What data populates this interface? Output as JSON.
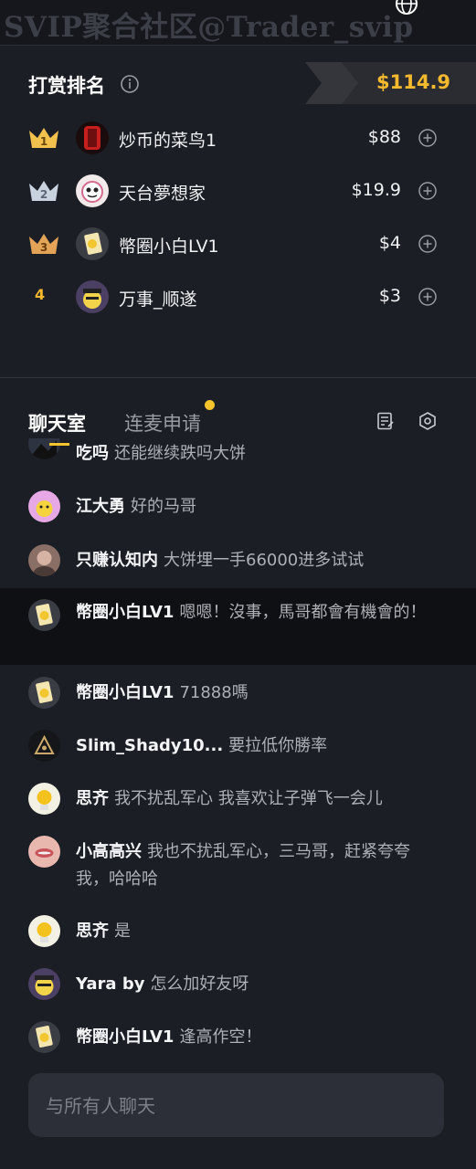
{
  "watermark": "SVIP聚合社区@Trader_svip",
  "rank": {
    "title": "打赏排名",
    "total": "$114.9",
    "entries": [
      {
        "rank": "1",
        "name": "炒币的菜鸟1",
        "amount": "$88"
      },
      {
        "rank": "2",
        "name": "天台夢想家",
        "amount": "$19.9"
      },
      {
        "rank": "3",
        "name": "幣圈小白LV1",
        "amount": "$4"
      },
      {
        "rank": "4",
        "name": "万事_顺遂",
        "amount": "$3"
      }
    ]
  },
  "tabs": {
    "chat": "聊天室",
    "mic": "连麦申请"
  },
  "messages": [
    {
      "user": "吃吗",
      "text": "还能继续跌吗大饼"
    },
    {
      "user": "江大勇",
      "text": "好的马哥"
    },
    {
      "user": "只赚认知内",
      "text": "大饼埋一手66000进多试试"
    },
    {
      "user": "幣圈小白LV1",
      "text": "嗯嗯！沒事，馬哥都會有機會的！"
    },
    {
      "user": "幣圈小白LV1",
      "text": "71888嗎"
    },
    {
      "user": "Slim_Shady10...",
      "text": "要拉低你勝率"
    },
    {
      "user": "思齐",
      "text": "我不扰乱军心 我喜欢让子弹飞一会儿"
    },
    {
      "user": "小高高兴",
      "text": "我也不扰乱军心，三马哥，赶紧夸夸我，哈哈哈"
    },
    {
      "user": "思齐",
      "text": "是"
    },
    {
      "user": "Yara by",
      "text": "怎么加好友呀"
    },
    {
      "user": "幣圈小白LV1",
      "text": "逢高作空！"
    }
  ],
  "input": {
    "placeholder": "与所有人聊天"
  },
  "colors": {
    "background": "#1b1e25",
    "accent_gold": "#f5b92e",
    "highlight_row": "#0f1014",
    "input_bg": "#2c2f37"
  },
  "icons": [
    "globe-icon",
    "info-icon",
    "crown-gold-icon",
    "crown-silver-icon",
    "crown-bronze-icon",
    "add-circle-icon",
    "notes-icon",
    "settings-hex-icon"
  ]
}
